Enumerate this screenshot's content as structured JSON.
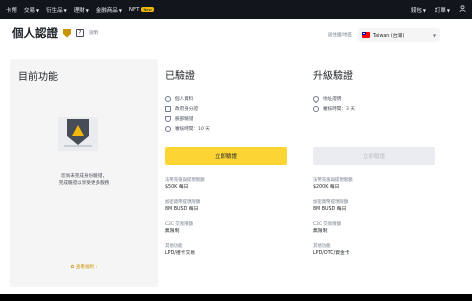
{
  "nav": {
    "left": [
      {
        "label": "卡幣",
        "caret": false
      },
      {
        "label": "交易",
        "caret": true
      },
      {
        "label": "衍生品",
        "caret": true
      },
      {
        "label": "理財",
        "caret": true
      },
      {
        "label": "金融商品",
        "caret": true
      },
      {
        "label": "NFT",
        "caret": false,
        "badge": "New"
      }
    ],
    "right": [
      {
        "label": "錢包",
        "caret": true
      },
      {
        "label": "訂單",
        "caret": true
      },
      {
        "label": "",
        "icon": "user-icon"
      }
    ]
  },
  "header": {
    "title": "個人認證",
    "help_link": "說明"
  },
  "residence": {
    "label": "居住國/地區",
    "country": "Taiwan (台灣)",
    "flag_icon": "taiwan-flag-icon"
  },
  "current": {
    "title": "目前功能",
    "message_lines": [
      "您尚未完成身份驗證，",
      "完成驗證以享受更多服務"
    ],
    "benefits_link": "查看福利"
  },
  "verified": {
    "title": "已驗證",
    "features": [
      {
        "icon": "user-icon",
        "label": "個人資料"
      },
      {
        "icon": "id-card-icon",
        "label": "政府身分證"
      },
      {
        "icon": "face-icon",
        "label": "臉部驗證"
      },
      {
        "icon": "limit-icon",
        "label": "審核時間：10 天"
      }
    ],
    "button": "立即驗證",
    "limits": [
      {
        "label": "法幣充值與提現限額",
        "value": "$50K 每日"
      },
      {
        "label": "加密貨幣提現限額",
        "value": "8M BUSD 每日"
      },
      {
        "label": "C2C 交易限額",
        "value": "無限制"
      },
      {
        "label": "其他功能",
        "value": "LPD/禮卡交易"
      }
    ]
  },
  "advanced": {
    "title": "升級驗證",
    "features": [
      {
        "icon": "location-icon",
        "label": "地址證明"
      },
      {
        "icon": "limit-icon",
        "label": "審核時間：3 天"
      }
    ],
    "button": "立即驗證",
    "limits": [
      {
        "label": "法幣充值與提現限額",
        "value": "$200K 每日"
      },
      {
        "label": "加密貨幣提現限額",
        "value": "8M BUSD 每日"
      },
      {
        "label": "C2C 交易限額",
        "value": "無限制"
      },
      {
        "label": "其他功能",
        "value": "LPD/OTC/資金卡"
      }
    ]
  }
}
